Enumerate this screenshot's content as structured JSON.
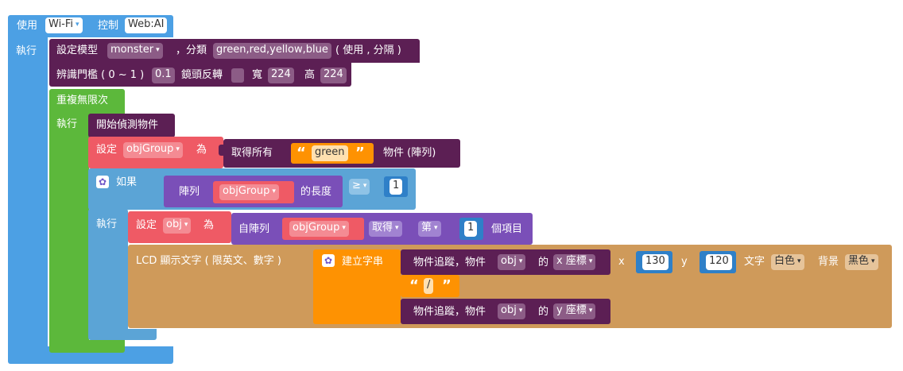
{
  "top": {
    "use_label": "使用",
    "connection": "Wi-Fi",
    "control_label": "控制",
    "target": "Web:AI"
  },
  "main": {
    "do_label": "執行",
    "setup": {
      "label": "設定模型",
      "model": "monster",
      "classes_label": "，分類",
      "classes": "green,red,yellow,blue",
      "classes_hint": "( 使用 , 分隔 )",
      "threshold_label": "辨識門檻 ( 0 ~ 1 )",
      "threshold": "0.1",
      "mirror_label": "鏡頭反轉",
      "width_label": "寬",
      "width": "224",
      "height_label": "高",
      "height": "224"
    },
    "loop": {
      "label": "重複無限次",
      "do_label": "執行",
      "start_detect": "開始偵測物件",
      "set1": {
        "label": "設定",
        "var": "objGroup",
        "as": "為",
        "get_all": "取得所有",
        "color": "green",
        "suffix": "物件 (陣列)"
      },
      "if_block": {
        "if_label": "如果",
        "array_label": "陣列",
        "var": "objGroup",
        "length_label": "的長度",
        "op": "≥",
        "compare": "1",
        "do_label": "執行",
        "set2": {
          "label": "設定",
          "var": "obj",
          "as": "為",
          "from_array": "自陣列",
          "array_var": "objGroup",
          "get": "取得",
          "which": "第",
          "index": "1",
          "item": "個項目"
        },
        "lcd": {
          "label": "LCD 顯示文字 ( 限英文、數字 )",
          "join_label": "建立字串",
          "track_label": "物件追蹤，物件",
          "var": "obj",
          "of": "的",
          "x_coord": "x 座標",
          "sep": "/",
          "y_coord": "y 座標",
          "x_label": "x",
          "x": "130",
          "y_label": "y",
          "y": "120",
          "text_label": "文字",
          "text_color": "白色",
          "bg_label": "背景",
          "bg_color": "黑色"
        }
      }
    }
  },
  "dropdown_arrow": "▾",
  "gear_glyph": "✿",
  "colors": {
    "wifi": "#4ca0e4",
    "loop": "#5cb83b",
    "ai": "#5c1f54",
    "var": "#ef5a65",
    "logic": "#5ba4d6",
    "list": "#7a4fb8",
    "lcd": "#cf9a5a",
    "text": "#fe9202"
  }
}
